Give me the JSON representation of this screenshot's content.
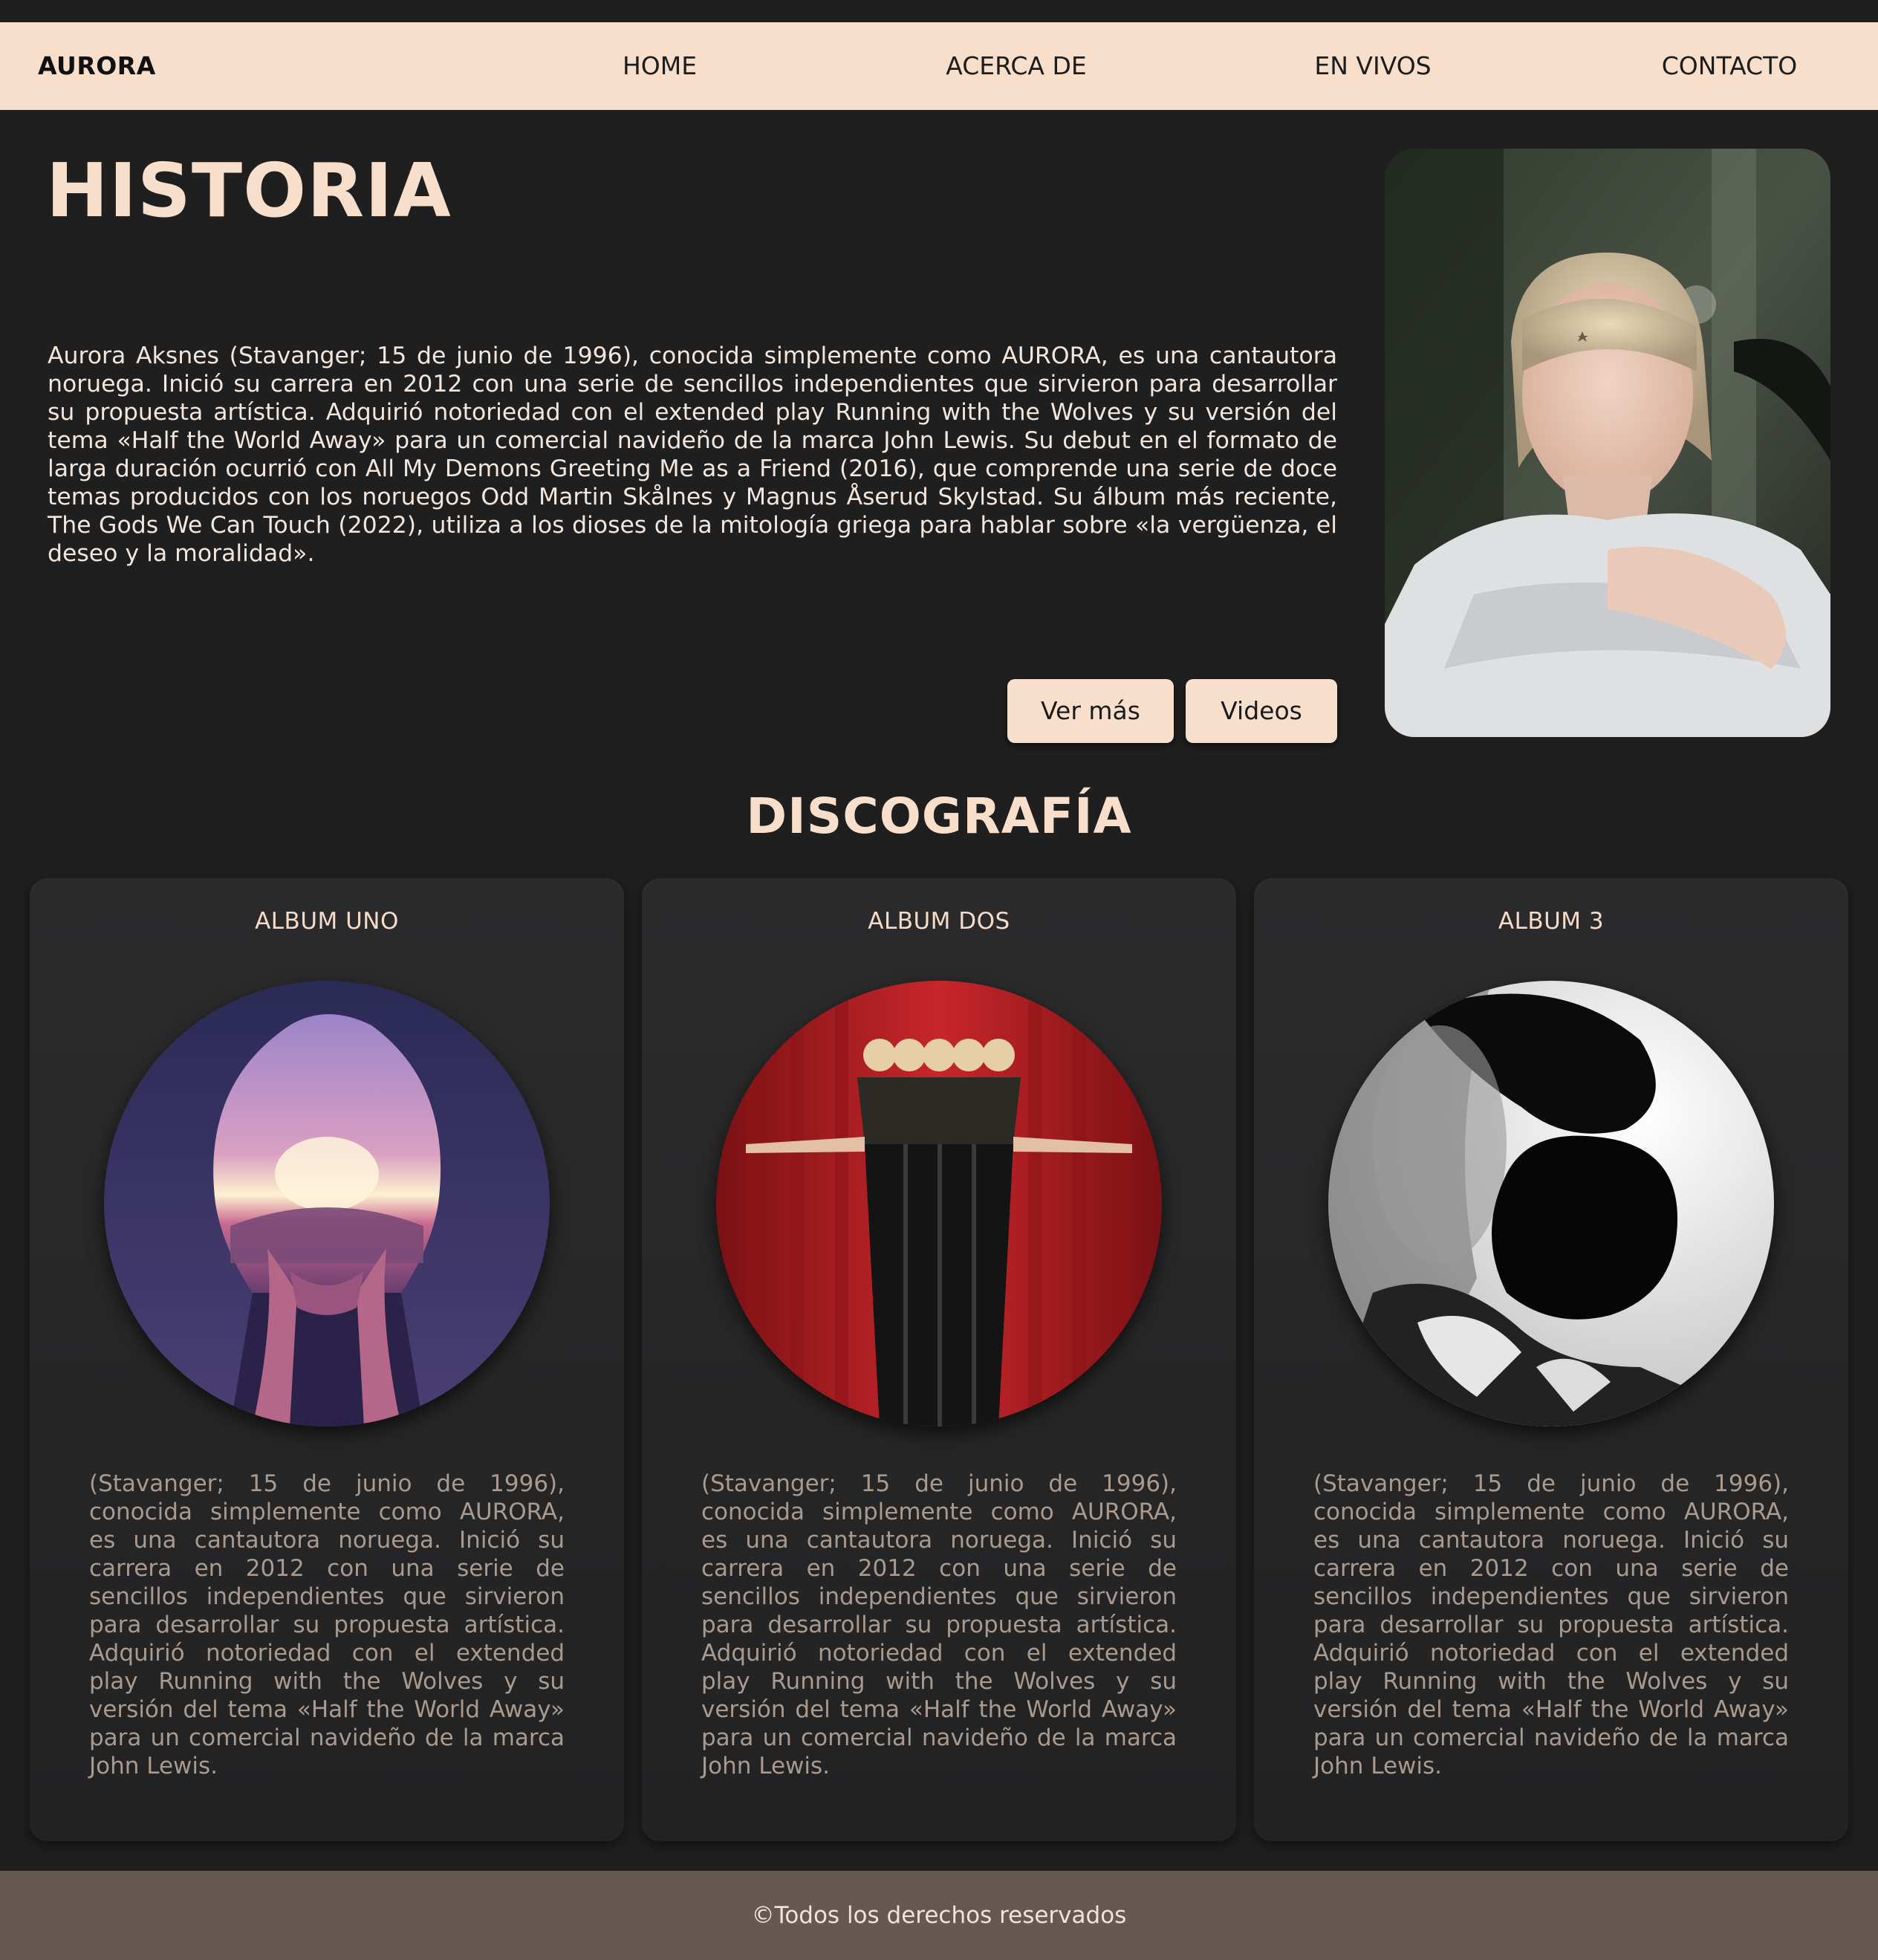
{
  "nav": {
    "brand": "AURORA",
    "links": [
      "HOME",
      "ACERCA DE",
      "EN VIVOS",
      "CONTACTO"
    ]
  },
  "hero": {
    "title": "HISTORIA",
    "text": "Aurora Aksnes (Stavanger; 15 de junio de 1996), conocida simplemente como AURORA, es una cantautora noruega. Inició su carrera en 2012 con una serie de sencillos independientes que sirvieron para desarrollar su propuesta artística. Adquirió notoriedad con el extended play Running with the Wolves y su versión del tema «Half the World Away» para un comercial navideño de la marca John Lewis. Su debut en el formato de larga duración ocurrió con All My Demons Greeting Me as a Friend (2016), que comprende una serie de doce temas producidos con los noruegos Odd Martin Skålnes y Magnus Åserud Skylstad. Su álbum más reciente, The Gods We Can Touch (2022), utiliza a los dioses de la mitología griega para hablar sobre «la vergüenza, el deseo y la moralidad».",
    "buttons": [
      "Ver más",
      "Videos"
    ]
  },
  "discography": {
    "title": "DISCOGRAFÍA",
    "albums": [
      {
        "title": "ALBUM UNO",
        "text": "(Stavanger; 15 de junio de 1996), conocida simplemente como AURORA, es una cantautora noruega. Inició su carrera en 2012 con una serie de sencillos independientes que sirvieron para desarrollar su propuesta artística. Adquirió notoriedad con el extended play Running with the Wolves y su versión del tema «Half the World Away» para un comercial navideño de la marca John Lewis."
      },
      {
        "title": "ALBUM DOS",
        "text": "(Stavanger; 15 de junio de 1996), conocida simplemente como AURORA, es una cantautora noruega. Inició su carrera en 2012 con una serie de sencillos independientes que sirvieron para desarrollar su propuesta artística. Adquirió notoriedad con el extended play Running with the Wolves y su versión del tema «Half the World Away» para un comercial navideño de la marca John Lewis."
      },
      {
        "title": "ALBUM 3",
        "text": "(Stavanger; 15 de junio de 1996), conocida simplemente como AURORA, es una cantautora noruega. Inició su carrera en 2012 con una serie de sencillos independientes que sirvieron para desarrollar su propuesta artística. Adquirió notoriedad con el extended play Running with the Wolves y su versión del tema «Half the World Away» para un comercial navideño de la marca John Lewis."
      }
    ]
  },
  "footer": {
    "text": "©Todos los derechos reservados"
  },
  "colors": {
    "background": "#1f1f20",
    "accent": "#f8dfcb",
    "footer": "#665852",
    "card_text": "#a99a8f"
  }
}
